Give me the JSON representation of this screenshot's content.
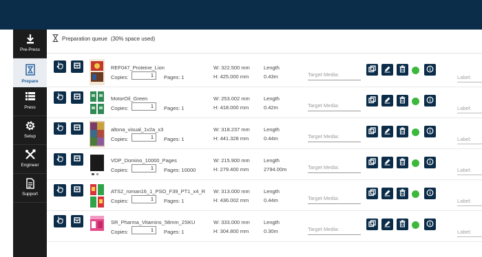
{
  "nav": {
    "items": [
      {
        "label": "Pre-Press",
        "icon": "download-icon"
      },
      {
        "label": "Prepare",
        "icon": "hourglass-icon",
        "active": true
      },
      {
        "label": "Press",
        "icon": "list-icon"
      },
      {
        "label": "Setup",
        "icon": "gear-icon"
      },
      {
        "label": "Engineer",
        "icon": "tools-icon"
      },
      {
        "label": "Support",
        "icon": "document-icon"
      }
    ]
  },
  "queue": {
    "title": "Preparation queue",
    "space": "(30% space used)"
  },
  "labels": {
    "copies": "Copies:",
    "length": "Length",
    "target_media_placeholder": "Target Media:",
    "label_placeholder": "Label:"
  },
  "colors": {
    "header": "#0b2d4a",
    "sidebar": "#1c1c1c",
    "status_ok": "#3db83d"
  },
  "jobs": [
    {
      "name": "REF047_Proteine_Lion",
      "copies": "1",
      "pages": "Pages: 1",
      "width": "W: 322.500 mm",
      "height": "H: 425.000 mm",
      "length": "0.43m",
      "status": "ok"
    },
    {
      "name": "MotorOil_Green",
      "copies": "1",
      "pages": "Pages: 1",
      "width": "W: 253.002 mm",
      "height": "H: 418.000 mm",
      "length": "0.42m",
      "status": "ok"
    },
    {
      "name": "altona_visual_1v2a_x3",
      "copies": "1",
      "pages": "Pages: 1",
      "width": "W: 318.237 mm",
      "height": "H: 441.328 mm",
      "length": "0.44m",
      "status": "ok"
    },
    {
      "name": "VDP_Domino_10000_Pages",
      "copies": "1",
      "pages": "Pages: 10000",
      "width": "W: 215.900 mm",
      "height": "H: 279.400 mm",
      "length": "2794.00m",
      "status": "ok"
    },
    {
      "name": "ATS2_roman16_1_PSO_F39_PT1_x4_R",
      "copies": "1",
      "pages": "Pages: 1",
      "width": "W: 313.000 mm",
      "height": "H: 436.002 mm",
      "length": "0.44m",
      "status": "ok"
    },
    {
      "name": "SR_Pharma_Vitamins_58mm_2SKU",
      "copies": "1",
      "pages": "Pages: 1",
      "width": "W: 333.000 mm",
      "height": "H: 304.800 mm",
      "length": "0.30m",
      "status": "ok"
    }
  ]
}
